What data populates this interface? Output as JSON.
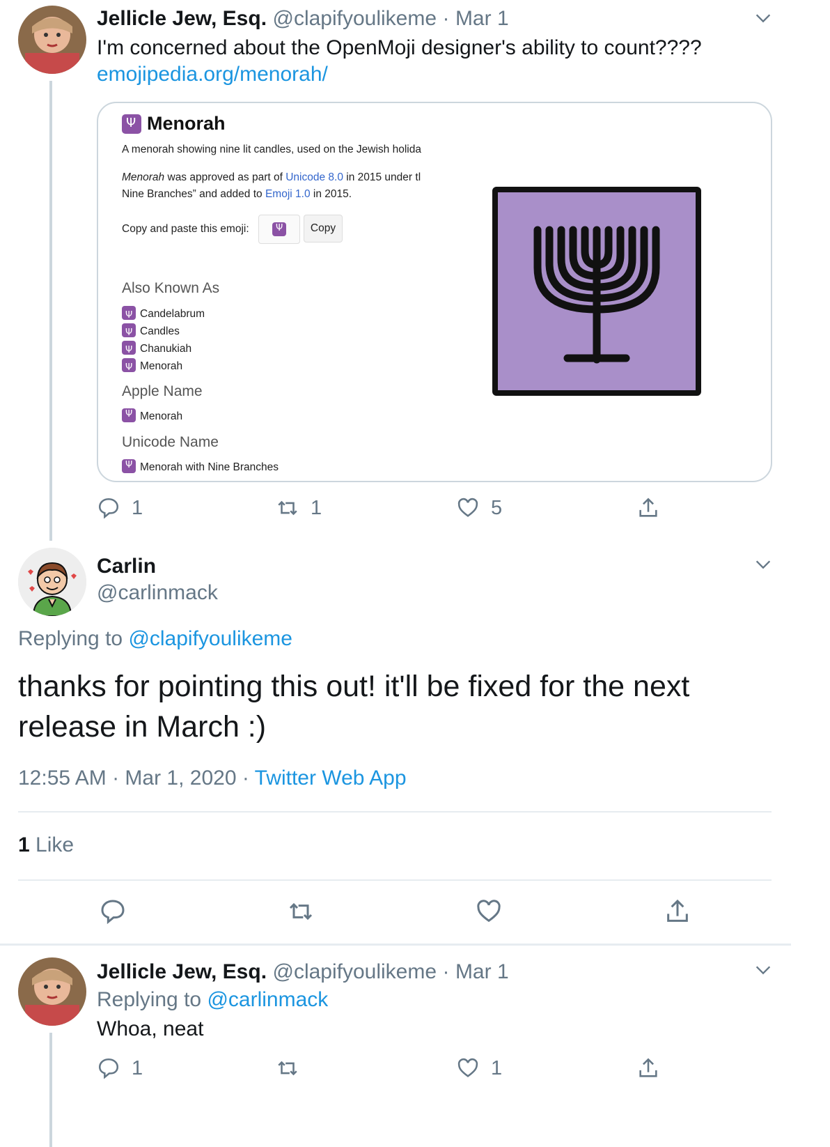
{
  "tweet1": {
    "name": "Jellicle Jew, Esq.",
    "handle": "@clapifyoulikeme",
    "dot": "·",
    "date": "Mar 1",
    "text": "I'm concerned about the OpenMoji designer's ability to count????",
    "link": "emojipedia.org/menorah/",
    "card": {
      "title": "Menorah",
      "desc": "A menorah showing nine lit candles, used on the Jewish holida",
      "approved_pre": "Menorah",
      "approved_mid": " was approved as part of ",
      "unicode_link": "Unicode 8.0",
      "approved_post": " in 2015 under tl",
      "nine_branches": "Nine Branches” and added to ",
      "emoji_link": "Emoji 1.0",
      "nine_post": " in 2015.",
      "copy_label": "Copy and paste this emoji:",
      "copy_button": "Copy",
      "aka_heading": "Also Known As",
      "aka_items": [
        "Candelabrum",
        "Candles",
        "Chanukiah",
        "Menorah"
      ],
      "apple_heading": "Apple Name",
      "apple_name": "Menorah",
      "unicode_heading": "Unicode Name",
      "unicode_name": "Menorah with Nine Branches"
    },
    "actions": {
      "replies": "1",
      "retweets": "1",
      "likes": "5"
    }
  },
  "tweet2": {
    "name": "Carlin",
    "handle": "@carlinmack",
    "replying_label": "Replying to",
    "replying_handle": "@clapifyoulikeme",
    "text": "thanks for pointing this out! it'll be fixed for the next release in March :)",
    "time": "12:55 AM · Mar 1, 2020 · ",
    "source": "Twitter Web App",
    "likes_count": "1",
    "likes_label": "Like"
  },
  "tweet3": {
    "name": "Jellicle Jew, Esq.",
    "handle": "@clapifyoulikeme",
    "dot": "·",
    "date": "Mar 1",
    "replying_label": "Replying to",
    "replying_handle": "@carlinmack",
    "text": "Whoa, neat",
    "actions": {
      "replies": "1",
      "retweets": "",
      "likes": "1"
    }
  },
  "colors": {
    "link": "#1b95e0",
    "muted": "#657786",
    "emoji_purple": "#a98fc9"
  },
  "icons": [
    "reply-icon",
    "retweet-icon",
    "like-icon",
    "share-icon",
    "chevron-down-icon",
    "menorah-emoji-icon"
  ]
}
